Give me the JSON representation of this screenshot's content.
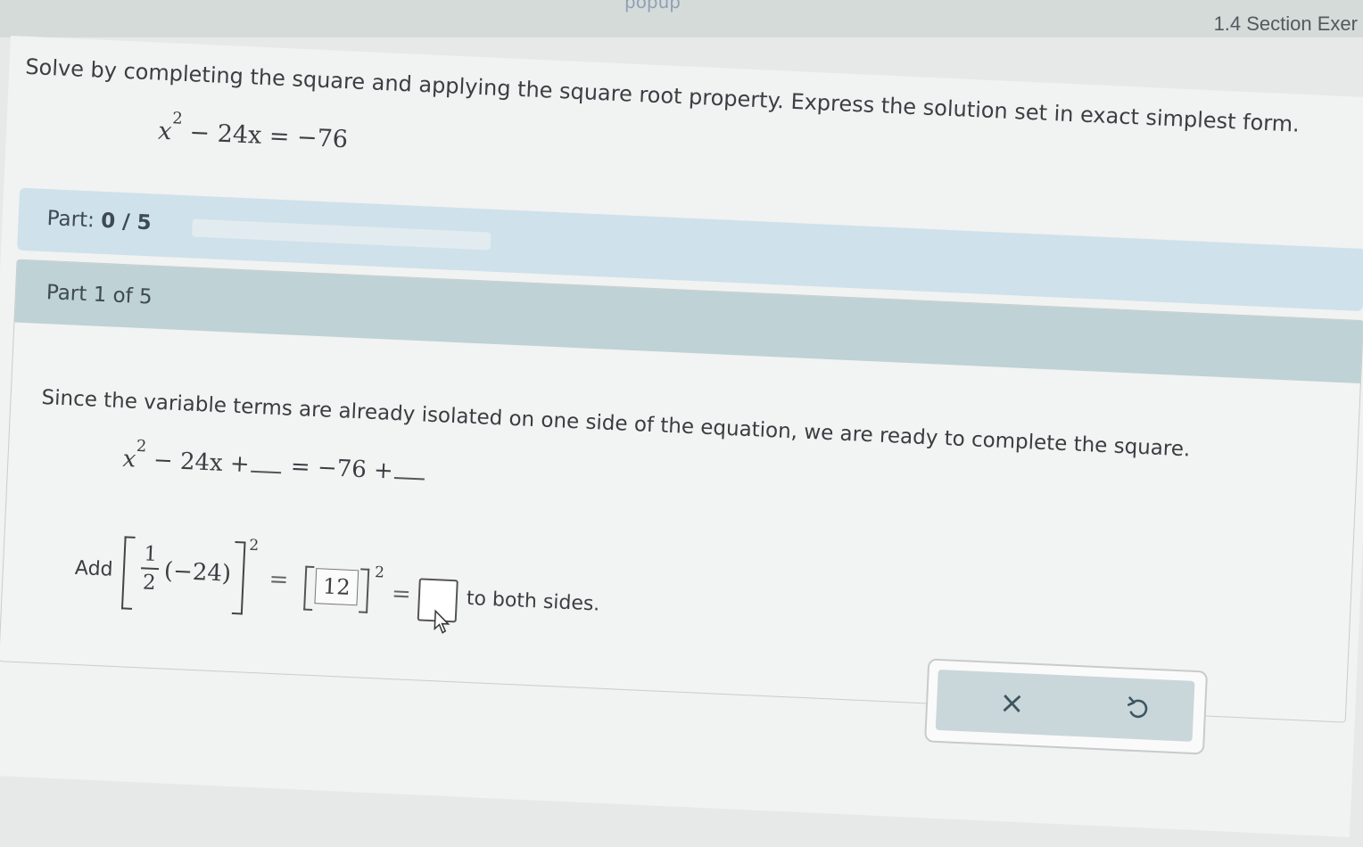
{
  "header": {
    "popup_label": "popup",
    "section_title": "1.4 Section Exer"
  },
  "problem": {
    "instructions": "Solve by completing the square and applying the square root property. Express the solution set in exact simplest form.",
    "equation": {
      "var": "x",
      "exp": "2",
      "rest": "− 24x  = −76"
    }
  },
  "progress": {
    "label_prefix": "Part: ",
    "current": "0",
    "separator": " / ",
    "total": "5",
    "fraction_complete": 0
  },
  "part": {
    "title": "Part 1 of 5",
    "explanation": "Since the variable terms are already isolated on one side of the equation, we are ready to complete the square.",
    "equation2": {
      "var": "x",
      "exp": "2",
      "mid": "− 24x +",
      "eq": " = −76 +"
    },
    "add_row": {
      "add_label": "Add",
      "frac_num": "1",
      "frac_den": "2",
      "paren_value": "(−24)",
      "exponent": "2",
      "equals": "=",
      "answer_value": "12",
      "answer_exponent": "2",
      "equals2": "=",
      "suffix": "to both sides."
    }
  },
  "buttons": {
    "clear": "×"
  }
}
